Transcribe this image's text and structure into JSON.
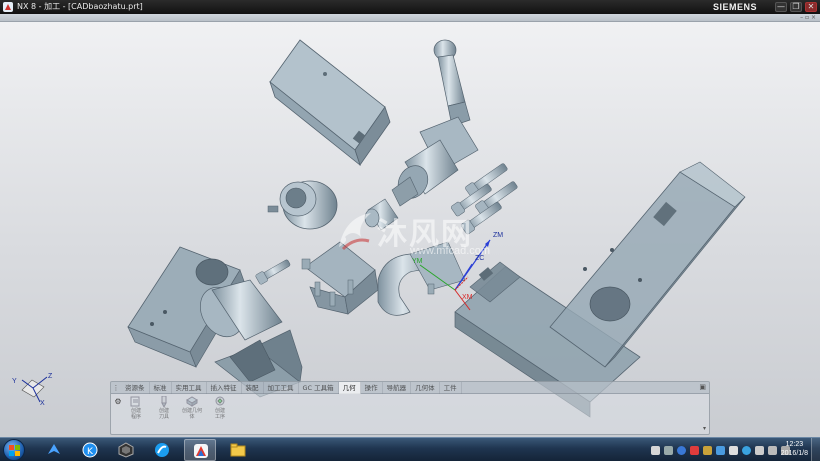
{
  "window": {
    "title": "NX 8 - 加工 - [CADbaozhatu.prt]",
    "brand": "SIEMENS",
    "minimize": "—",
    "restore": "❐",
    "close": "✕"
  },
  "watermark": {
    "text": "沐风网",
    "url": "www.mfcad.com"
  },
  "mcs_labels": {
    "zm": "ZM",
    "zc": "ZC",
    "ym": "YM",
    "xm": "XM"
  },
  "view_triad": {
    "x": "X",
    "y": "Y",
    "z": "Z"
  },
  "toolbar_panel": {
    "tabs": [
      "资源条",
      "标准",
      "实用工具",
      "插入特征",
      "装配",
      "加工工具",
      "GC 工具箱",
      "几何",
      "操作",
      "导航器",
      "几何体",
      "工件"
    ],
    "active_tab_index": 7,
    "tools": [
      {
        "label": "创建\n程序",
        "icon": "create-program-icon"
      },
      {
        "label": "创建\n刀具",
        "icon": "create-tool-icon"
      },
      {
        "label": "创建几何\n体",
        "icon": "create-geometry-icon"
      },
      {
        "label": "创建\n工序",
        "icon": "create-operation-icon"
      }
    ]
  },
  "taskbar": {
    "apps": [
      "xunlei-icon",
      "kugou-icon",
      "nx-cube-icon",
      "browser-icon",
      "nx-app-icon",
      "explorer-icon"
    ],
    "active_app_index": 4,
    "clock_time": "12:23",
    "clock_date": "2016/1/8"
  },
  "colors": {
    "part_fill": "#9fb1bd",
    "part_shadow": "#6d808d",
    "part_highlight": "#cfdae2",
    "zm_axis": "#2a3fd6",
    "zc_axis": "#2a3fd6",
    "x_axis": "#d62a2a",
    "y_axis": "#2aa62a",
    "taskbar": "#1f3550"
  }
}
